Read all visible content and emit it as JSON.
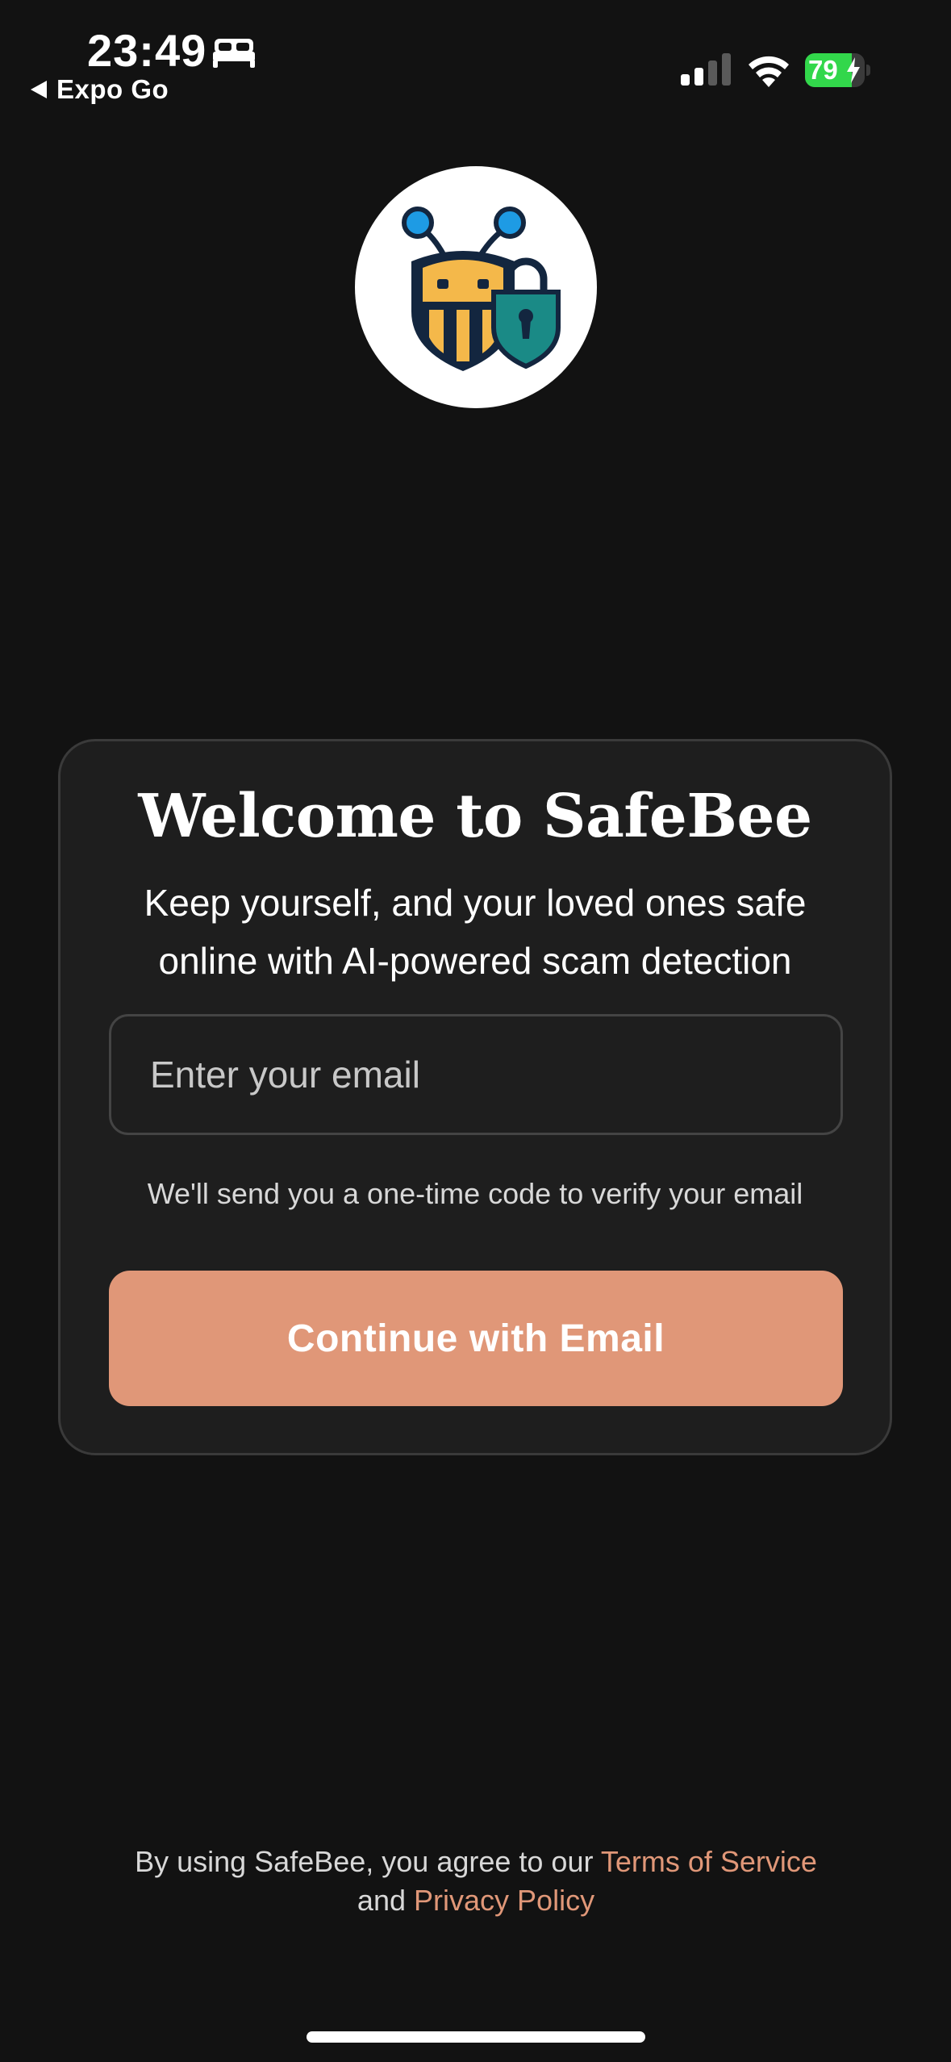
{
  "status_bar": {
    "time": "23:49",
    "back_app_label": "Expo Go",
    "battery_percent": 79,
    "battery_text": "79",
    "battery_charging": true,
    "battery_color": "#32d74b"
  },
  "logo": {
    "icon": "bee-shield-lock-logo"
  },
  "welcome_card": {
    "title": "Welcome to SafeBee",
    "subtitle": "Keep yourself, and your loved ones safe online with AI-powered scam detection",
    "email_placeholder": "Enter your email",
    "email_value": "",
    "helper_text": "We'll send you a one-time code to verify your email",
    "continue_label": "Continue with Email"
  },
  "footer": {
    "legal_prefix": "By using SafeBee, you agree to our",
    "terms_link": "Terms of Service",
    "legal_and": "and",
    "privacy_link": "Privacy Policy"
  },
  "colors": {
    "background": "#121212",
    "card": "#1e1e1e",
    "accent": "#e09778",
    "logo_navy": "#13263f",
    "logo_yellow": "#f4b84a",
    "logo_blue": "#1e9be4",
    "logo_teal": "#1a8a86"
  }
}
